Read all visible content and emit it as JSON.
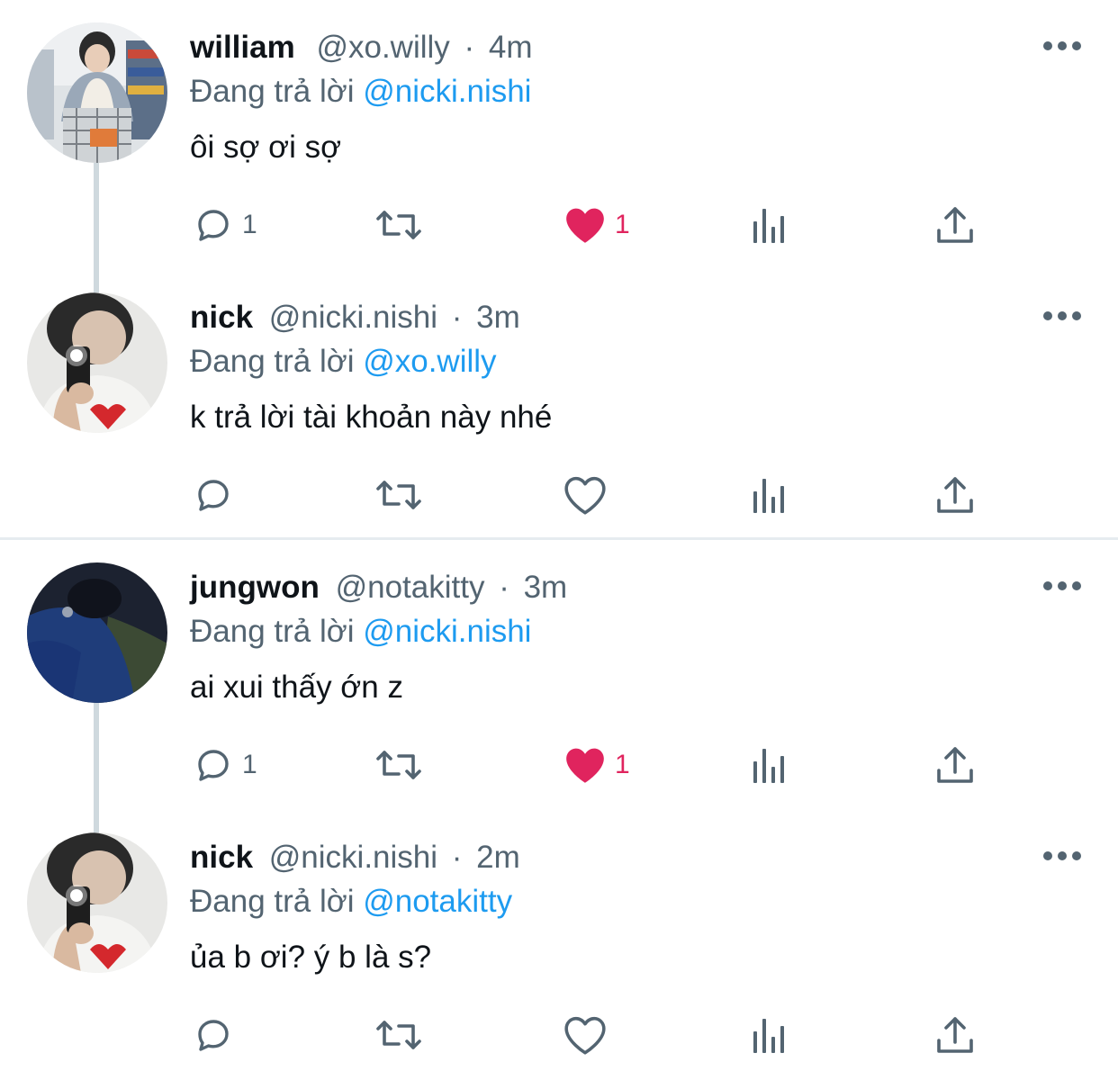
{
  "colors": {
    "text": "#0f1419",
    "muted": "#536471",
    "mention": "#1d9bf0",
    "like": "#e0245e",
    "thread_line": "#cfd9de"
  },
  "tweets": [
    {
      "name": "william",
      "handle": "@xo.willy",
      "separator": "·",
      "time": "4m",
      "reply_prefix": "Đang trả lời",
      "reply_to": "@nicki.nishi",
      "text": "ôi sợ ơi sợ",
      "reply_count": "1",
      "like_count": "1",
      "liked": true
    },
    {
      "name": "nick",
      "handle": "@nicki.nishi",
      "separator": "·",
      "time": "3m",
      "reply_prefix": "Đang trả lời",
      "reply_to": "@xo.willy",
      "text": "k trả lời tài khoản này nhé",
      "reply_count": "",
      "like_count": "",
      "liked": false
    },
    {
      "name": "jungwon",
      "handle": "@notakitty",
      "separator": "·",
      "time": "3m",
      "reply_prefix": "Đang trả lời",
      "reply_to": "@nicki.nishi",
      "text": "ai xui thấy ớn z",
      "reply_count": "1",
      "like_count": "1",
      "liked": true
    },
    {
      "name": "nick",
      "handle": "@nicki.nishi",
      "separator": "·",
      "time": "2m",
      "reply_prefix": "Đang trả lời",
      "reply_to": "@notakitty",
      "text": "ủa b ơi? ý b là s?",
      "reply_count": "",
      "like_count": "",
      "liked": false
    }
  ],
  "icons": {
    "reply": "speech-bubble-icon",
    "retweet": "retweet-arrows-icon",
    "like": "heart-icon",
    "views": "bar-chart-icon",
    "share": "share-upload-icon",
    "more": "ellipsis-icon"
  }
}
